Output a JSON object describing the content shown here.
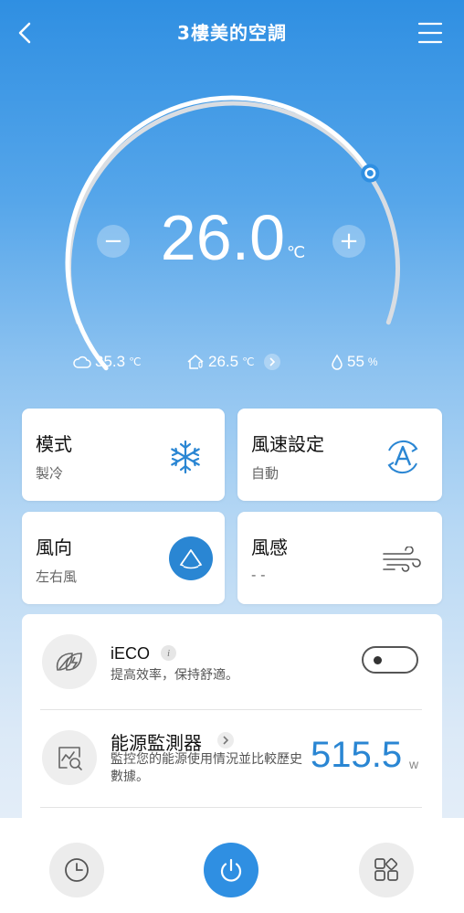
{
  "header": {
    "title": "3樓美的空調",
    "back_icon": "chevron-left-icon",
    "menu_icon": "hamburger-menu-icon"
  },
  "dial": {
    "temperature": "26.0",
    "unit": "℃",
    "minus_label": "−",
    "plus_label": "+",
    "setpoint_fraction": 0.72
  },
  "stats": {
    "outdoor": {
      "icon": "cloud-icon",
      "value": "35.3",
      "unit": "℃"
    },
    "indoor": {
      "icon": "home-thermometer-icon",
      "value": "26.5",
      "unit": "℃"
    },
    "humidity": {
      "icon": "droplet-icon",
      "value": "55",
      "unit": "%"
    }
  },
  "cards": {
    "mode": {
      "label": "模式",
      "value": "製冷",
      "icon": "snowflake-icon"
    },
    "fan_speed": {
      "label": "風速設定",
      "value": "自動",
      "icon": "auto-fan-icon"
    },
    "direction": {
      "label": "風向",
      "value": "左右風",
      "icon": "swing-left-right-icon"
    },
    "wind_feel": {
      "label": "風感",
      "value": "- -",
      "icon": "wind-icon"
    }
  },
  "eco": {
    "title": "iECO",
    "info": "i",
    "description": "提高效率，保持舒適。",
    "enabled": false
  },
  "monitor": {
    "title": "能源監測器",
    "description": "監控您的能源使用情況並比較歷史數據。",
    "value": "515.5",
    "unit": "w"
  },
  "bottom_bar": {
    "timer_icon": "clock-icon",
    "power_icon": "power-icon",
    "more_icon": "apps-grid-icon"
  },
  "colors": {
    "accent": "#2a86d3",
    "header_blue": "#2f8fe2"
  }
}
